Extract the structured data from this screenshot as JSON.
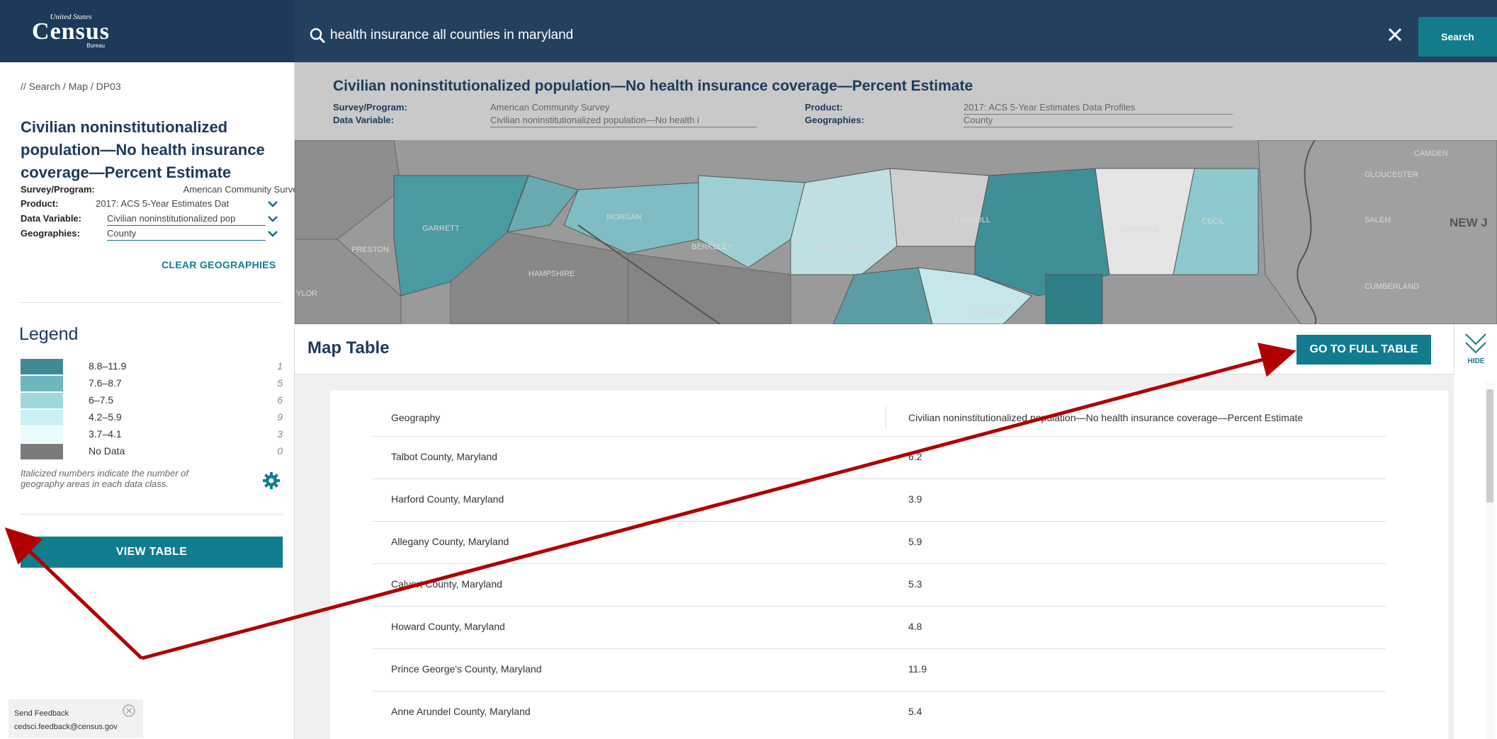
{
  "logo": {
    "top": "United States",
    "main": "Census",
    "bottom": "Bureau"
  },
  "search": {
    "query": "health insurance all counties in maryland",
    "button": "Search"
  },
  "breadcrumb": "// Search / Map / DP03",
  "title": "Civilian noninstitutionalized population—No health insurance coverage—Percent Estimate",
  "meta": {
    "survey_label": "Survey/Program:",
    "survey_value": "American Community Survey",
    "product_label": "Product:",
    "product_value": "2017: ACS 5-Year Estimates Data Profiles",
    "product_value_short": "2017: ACS 5-Year Estimates Dat",
    "variable_label": "Data Variable:",
    "variable_value": "Civilian noninstitutionalized population—No health i",
    "variable_value_short": "Civilian noninstitutionalized pop",
    "geo_label": "Geographies:",
    "geo_value": "County",
    "clear": "CLEAR GEOGRAPHIES"
  },
  "legend": {
    "title": "Legend",
    "items": [
      {
        "label": "8.8–11.9",
        "count": "1",
        "color": "#3f8a95"
      },
      {
        "label": "7.6–8.7",
        "count": "5",
        "color": "#6cb6c0"
      },
      {
        "label": "6–7.5",
        "count": "6",
        "color": "#9fd7dd"
      },
      {
        "label": "4.2–5.9",
        "count": "9",
        "color": "#c9f0f4"
      },
      {
        "label": "3.7–4.1",
        "count": "3",
        "color": "#e9fbfd"
      },
      {
        "label": "No Data",
        "count": "0",
        "color": "#7b7b7b"
      }
    ],
    "note": "Italicized numbers indicate the number of geography areas in each data class."
  },
  "view_table": "VIEW TABLE",
  "feedback": {
    "label": "Send Feedback",
    "email": "cedsci.feedback@census.gov"
  },
  "map": {
    "labels": {
      "preston": "PRESTON",
      "frederick": "FREDERICK",
      "carroll": "CARROLL",
      "harford": "HARFORD",
      "cecil": "CECIL",
      "howard": "HOWARD",
      "berkeley": "BERKELEY",
      "morgan": "MORGAN",
      "hampshire": "HAMPSHIRE",
      "garrett": "GARRETT",
      "salem": "SALEM",
      "new_j": "NEW J",
      "camden": "CAMDEN",
      "gloucester": "GLOUCESTER",
      "cumberland": "CUMBERLAND",
      "vlor": "YLOR"
    }
  },
  "table": {
    "heading": "Map Table",
    "full_table": "GO TO FULL TABLE",
    "hide": "HIDE",
    "columns": [
      "Geography",
      "Civilian noninstitutionalized population—No health insurance coverage—Percent Estimate"
    ],
    "rows": [
      [
        "Talbot County, Maryland",
        "6.2"
      ],
      [
        "Harford County, Maryland",
        "3.9"
      ],
      [
        "Allegany County, Maryland",
        "5.9"
      ],
      [
        "Calvert County, Maryland",
        "5.3"
      ],
      [
        "Howard County, Maryland",
        "4.8"
      ],
      [
        "Prince George's County, Maryland",
        "11.9"
      ],
      [
        "Anne Arundel County, Maryland",
        "5.4"
      ]
    ]
  },
  "colors": {
    "navy": "#1d3a5a",
    "teal": "#127c8f",
    "arrow": "#b00000"
  }
}
